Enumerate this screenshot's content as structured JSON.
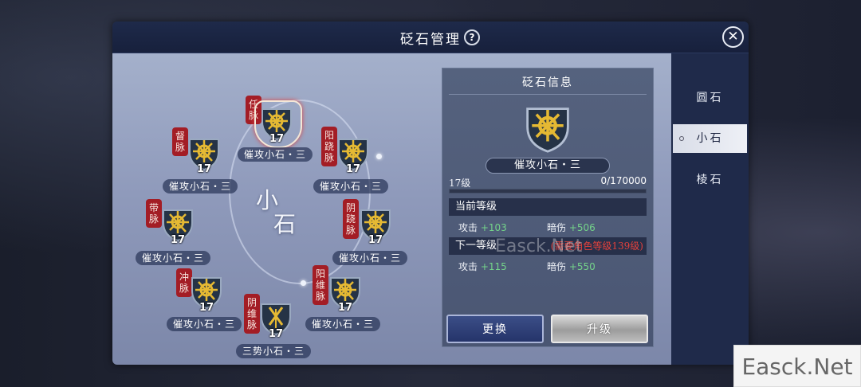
{
  "dialog": {
    "title": "砭石管理",
    "help_icon": "?",
    "close_icon": "✕"
  },
  "center_label": [
    "小",
    "石"
  ],
  "stones": [
    {
      "meridian": "任脉",
      "level": "17",
      "name": "催攻小石・三",
      "selected": true
    },
    {
      "meridian": "阳跷脉",
      "level": "17",
      "name": "催攻小石・三"
    },
    {
      "meridian": "阴跷脉",
      "level": "17",
      "name": "催攻小石・三"
    },
    {
      "meridian": "阳维脉",
      "level": "17",
      "name": "催攻小石・三"
    },
    {
      "meridian": "阴维脉",
      "level": "17",
      "name": "三势小石・三"
    },
    {
      "meridian": "冲脉",
      "level": "17",
      "name": "催攻小石・三"
    },
    {
      "meridian": "带脉",
      "level": "17",
      "name": "催攻小石・三"
    },
    {
      "meridian": "督脉",
      "level": "17",
      "name": "催攻小石・三"
    }
  ],
  "info": {
    "title": "砭石信息",
    "stone_name": "催攻小石・三",
    "level_label": "17级",
    "exp": "0/170000",
    "exp_progress": 0,
    "current_label": "当前等级",
    "current_stats": {
      "attack_label": "攻击",
      "attack_value": "+103",
      "crit_label": "暗伤",
      "crit_value": "+506"
    },
    "next_label": "下一等级",
    "next_requirement": "(需要角色等级139级)",
    "next_stats": {
      "attack_label": "攻击",
      "attack_value": "+115",
      "crit_label": "暗伤",
      "crit_value": "+550"
    },
    "swap_button": "更换",
    "upgrade_button": "升级"
  },
  "tabs": [
    {
      "label": "圆石",
      "active": false
    },
    {
      "label": "小石",
      "active": true
    },
    {
      "label": "棱石",
      "active": false
    }
  ],
  "watermark": "Easck.Net",
  "corner_watermark": "Easck.Net",
  "colors": {
    "meridian_red": "#a31d25",
    "stat_green": "#74d38a",
    "requirement_red": "#e2413c",
    "stone_gold": "#e5b933"
  }
}
